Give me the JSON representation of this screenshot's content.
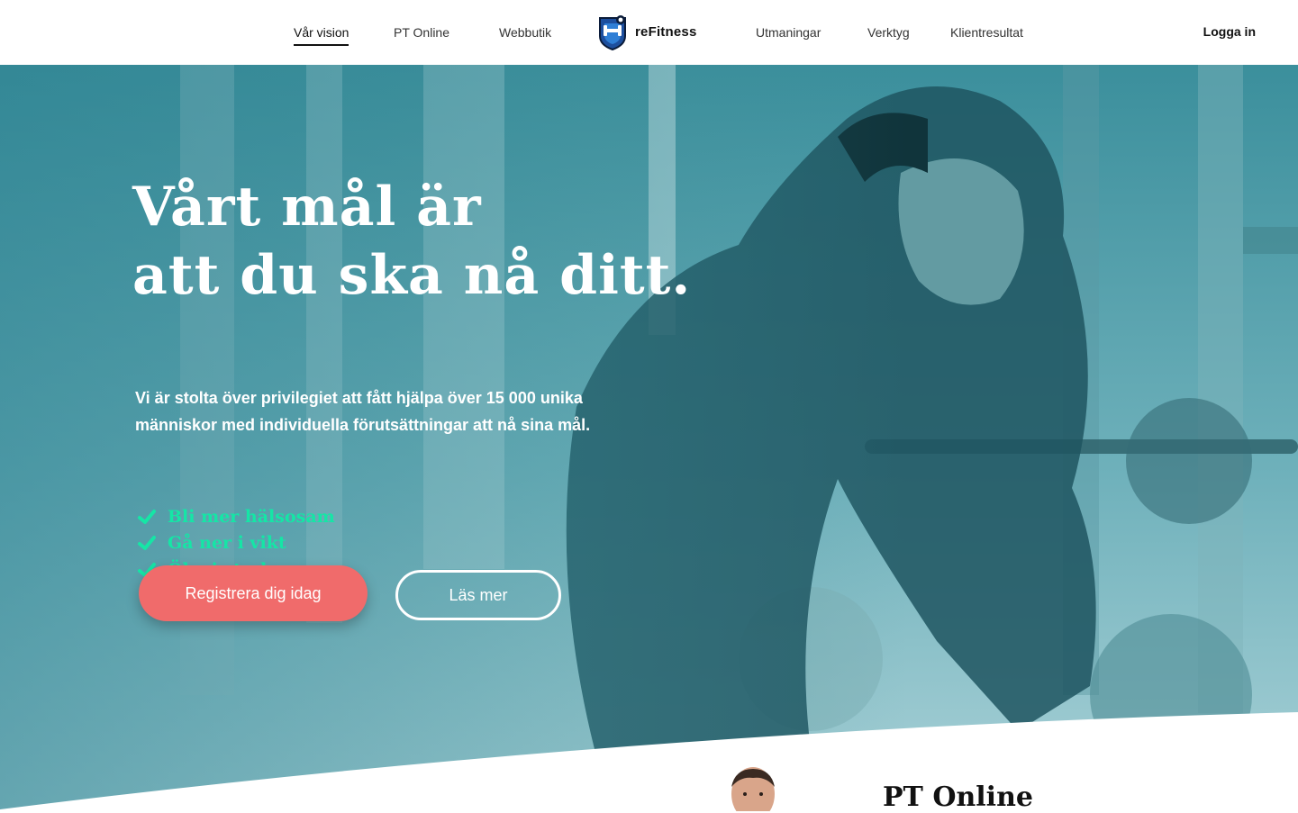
{
  "header": {
    "nav_left": [
      {
        "label": "Vår vision",
        "active": true
      },
      {
        "label": "PT Online",
        "active": false
      },
      {
        "label": "Webbutik",
        "active": false
      }
    ],
    "logo": {
      "text": "reFitness",
      "icon": "dumbbell-shield-icon"
    },
    "nav_right": [
      {
        "label": "Utmaningar"
      },
      {
        "label": "Verktyg"
      },
      {
        "label": "Klientresultat"
      }
    ],
    "login_label": "Logga in"
  },
  "hero": {
    "title_line1": "Vårt mål är",
    "title_line2": "att du ska nå ditt.",
    "description": "Vi är stolta över privilegiet att fått hjälpa över 15 000 unika människor med individuella förutsättningar att nå sina mål.",
    "benefits": [
      "Bli mer hälsosam",
      "Gå ner i vikt",
      "Öka i styrka"
    ],
    "primary_button": "Registrera dig idag",
    "secondary_button": "Läs mer"
  },
  "next_section": {
    "title": "PT Online"
  },
  "colors": {
    "accent_coral": "#f06b6b",
    "check_green": "#15e6a6",
    "hero_teal": "#3b8f9c"
  }
}
